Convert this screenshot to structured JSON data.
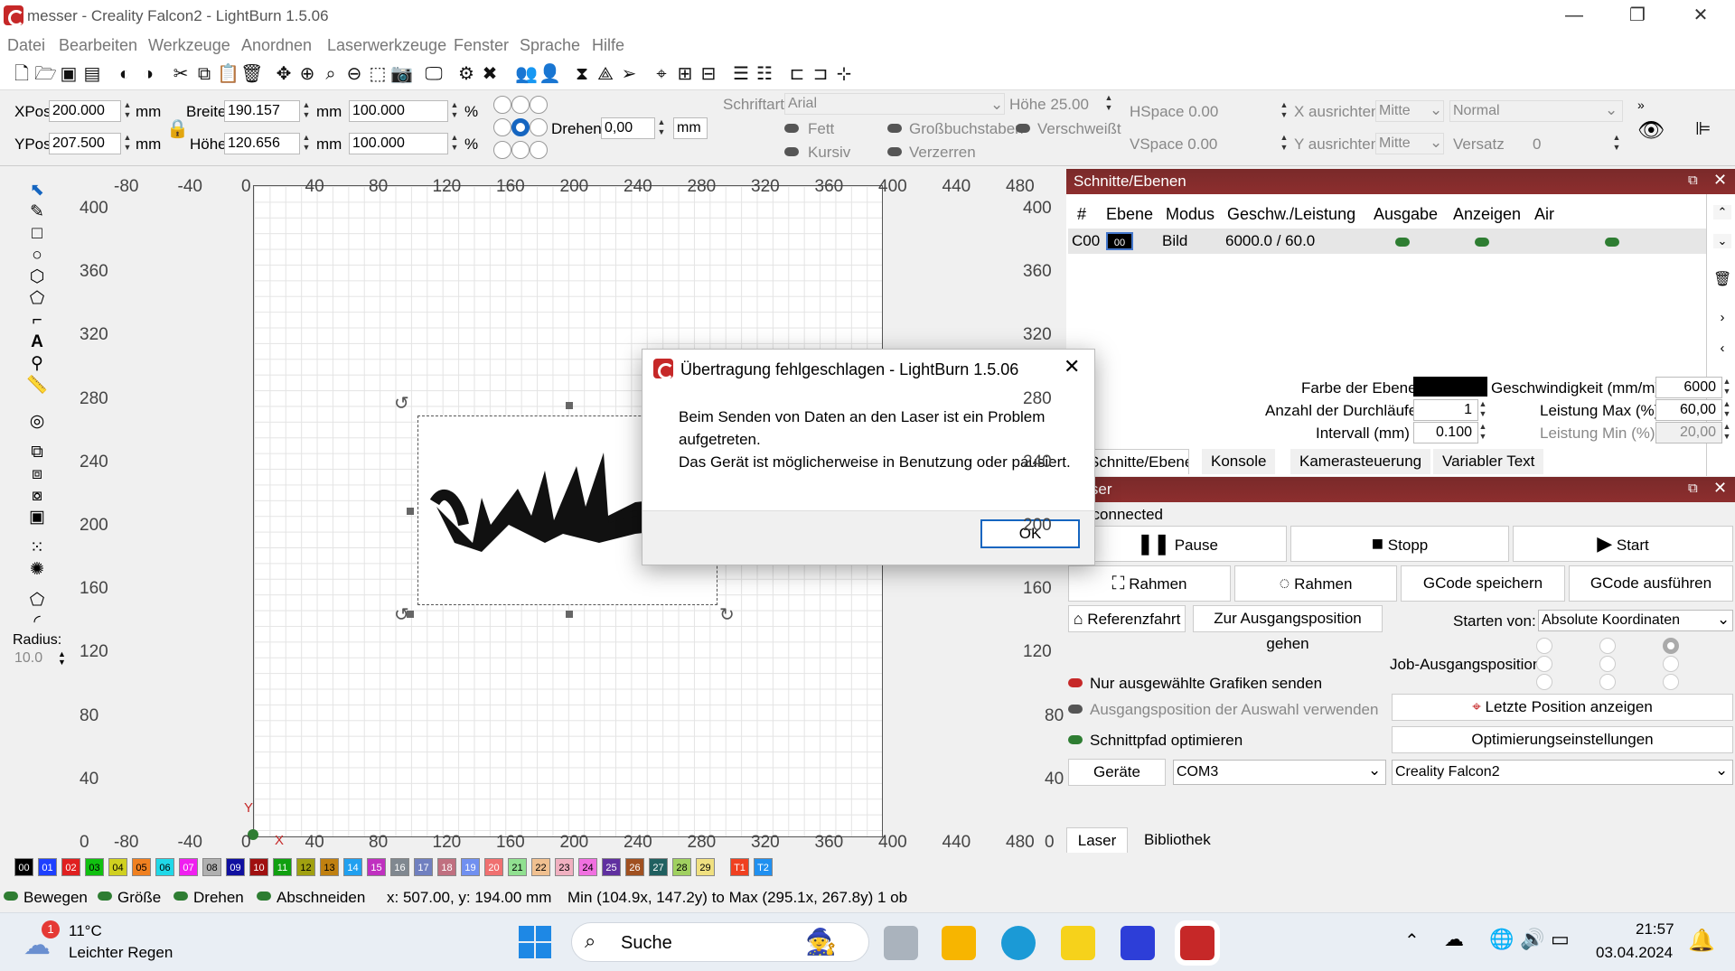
{
  "window": {
    "title": "messer - Creality Falcon2 - LightBurn 1.5.06"
  },
  "menu": [
    "Datei",
    "Bearbeiten",
    "Werkzeuge",
    "Anordnen",
    "Laserwerkzeuge",
    "Fenster",
    "Sprache",
    "Hilfe"
  ],
  "props": {
    "xpos_label": "XPos",
    "xpos": "200.000",
    "ypos_label": "YPos",
    "ypos": "207.500",
    "unit": "mm",
    "breite_label": "Breite",
    "breite": "190.157",
    "hoehe_label": "Höhe",
    "hoehe": "120.656",
    "scale_w": "100.000",
    "scale_h": "100.000",
    "percent": "%",
    "drehen_label": "Drehen",
    "drehen": "0,00",
    "drehen_unit": "mm",
    "schriftart_label": "Schriftart",
    "schriftart": "Arial",
    "hoehe_font": "Höhe 25.00",
    "hspace": "HSpace 0.00",
    "vspace": "VSpace 0.00",
    "x_ausrichten": "X ausrichten",
    "y_ausrichten": "Y ausrichten",
    "mitte": "Mitte",
    "normal": "Normal",
    "versatz": "Versatz",
    "versatz_val": "0",
    "fett": "Fett",
    "kursiv": "Kursiv",
    "gross": "Großbuchstaben",
    "verschweisst": "Verschweißt",
    "verzerren": "Verzerren"
  },
  "lefttools": {
    "radius_label": "Radius:",
    "radius": "10.0"
  },
  "ruler": {
    "top": [
      "-80",
      "-40",
      "0",
      "40",
      "80",
      "120",
      "160",
      "200",
      "240",
      "280",
      "320",
      "360",
      "400",
      "440",
      "480"
    ],
    "left": [
      "400",
      "360",
      "320",
      "280",
      "240",
      "200",
      "160",
      "120",
      "80",
      "40",
      "0"
    ],
    "right": [
      "400",
      "360",
      "320",
      "280",
      "240",
      "200",
      "160",
      "120",
      "80",
      "40",
      "0"
    ],
    "axis_x": "X",
    "axis_y": "Y"
  },
  "layers": {
    "title": "Schnitte/Ebenen",
    "headers": [
      "#",
      "Ebene",
      "Modus",
      "Geschw./Leistung",
      "Ausgabe",
      "Anzeigen",
      "Air"
    ],
    "row": {
      "id": "C00",
      "ebene": "00",
      "modus": "Bild",
      "speed": "6000.0 / 60.0"
    },
    "farbe_label": "Farbe der Ebene",
    "geschw_label": "Geschwindigkeit (mm/m)",
    "geschw": "6000",
    "durchlaeufe_label": "Anzahl der Durchläufe",
    "durchlaeufe": "1",
    "leistung_max_label": "Leistung Max (%)",
    "leistung_max": "60,00",
    "intervall_label": "Intervall (mm)",
    "intervall": "0.100",
    "leistung_min_label": "Leistung Min (%)",
    "leistung_min": "20,00",
    "tabs": [
      "Schnitte/Ebenen",
      "Konsole",
      "Kamerasteuerung",
      "Variabler Text"
    ]
  },
  "laser": {
    "title": "Laser",
    "status": "Disconnected",
    "pause": "Pause",
    "stopp": "Stopp",
    "start": "Start",
    "rahmen1": "Rahmen",
    "rahmen2": "Rahmen",
    "gcode_save": "GCode speichern",
    "gcode_run": "GCode ausführen",
    "referenz": "Referenzfahrt",
    "ausgang": "Zur Ausgangsposition gehen",
    "starten_label": "Starten von:",
    "starten": "Absolute Koordinaten",
    "job_label": "Job-Ausgangsposition",
    "nur_ausgewaehlt": "Nur ausgewählte Grafiken senden",
    "ausgang_auswahl": "Ausgangsposition der Auswahl verwenden",
    "letzte": "Letzte Position anzeigen",
    "optimieren": "Schnittpfad optimieren",
    "opt_settings": "Optimierungseinstellungen",
    "geraete": "Geräte",
    "port": "COM3",
    "device": "Creality Falcon2",
    "tabs": [
      "Laser",
      "Bibliothek"
    ]
  },
  "palette": [
    {
      "n": "00",
      "c": "#000000",
      "t": "#ffffff"
    },
    {
      "n": "01",
      "c": "#1e40ff",
      "t": "#ffffff"
    },
    {
      "n": "02",
      "c": "#e02020",
      "t": "#ffffff"
    },
    {
      "n": "03",
      "c": "#10c010",
      "t": "#000000"
    },
    {
      "n": "04",
      "c": "#d0d020",
      "t": "#000000"
    },
    {
      "n": "05",
      "c": "#f08020",
      "t": "#000000"
    },
    {
      "n": "06",
      "c": "#20d8e8",
      "t": "#000000"
    },
    {
      "n": "07",
      "c": "#f020f0",
      "t": "#ffffff"
    },
    {
      "n": "08",
      "c": "#b0b0b0",
      "t": "#000000"
    },
    {
      "n": "09",
      "c": "#1010a0",
      "t": "#ffffff"
    },
    {
      "n": "10",
      "c": "#a01010",
      "t": "#ffffff"
    },
    {
      "n": "11",
      "c": "#10a010",
      "t": "#ffffff"
    },
    {
      "n": "12",
      "c": "#a0a010",
      "t": "#000000"
    },
    {
      "n": "13",
      "c": "#c08010",
      "t": "#000000"
    },
    {
      "n": "14",
      "c": "#20a0f0",
      "t": "#ffffff"
    },
    {
      "n": "15",
      "c": "#c030c0",
      "t": "#ffffff"
    },
    {
      "n": "16",
      "c": "#808890",
      "t": "#ffffff"
    },
    {
      "n": "17",
      "c": "#7080c0",
      "t": "#ffffff"
    },
    {
      "n": "18",
      "c": "#c07080",
      "t": "#ffffff"
    },
    {
      "n": "19",
      "c": "#7090f0",
      "t": "#ffffff"
    },
    {
      "n": "20",
      "c": "#f07070",
      "t": "#ffffff"
    },
    {
      "n": "21",
      "c": "#90e090",
      "t": "#000000"
    },
    {
      "n": "22",
      "c": "#f0c090",
      "t": "#000000"
    },
    {
      "n": "23",
      "c": "#f0b0c0",
      "t": "#000000"
    },
    {
      "n": "24",
      "c": "#f070e0",
      "t": "#000000"
    },
    {
      "n": "25",
      "c": "#6030a0",
      "t": "#ffffff"
    },
    {
      "n": "26",
      "c": "#a05020",
      "t": "#ffffff"
    },
    {
      "n": "27",
      "c": "#206060",
      "t": "#ffffff"
    },
    {
      "n": "28",
      "c": "#a0d060",
      "t": "#000000"
    },
    {
      "n": "29",
      "c": "#f0e080",
      "t": "#000000"
    },
    {
      "n": "T1",
      "c": "#f04020",
      "t": "#ffffff"
    },
    {
      "n": "T2",
      "c": "#2090f0",
      "t": "#ffffff"
    }
  ],
  "status": {
    "bewegen": "Bewegen",
    "groesse": "Größe",
    "drehen": "Drehen",
    "abschneiden": "Abschneiden",
    "coords": "x: 507.00, y: 194.00 mm",
    "minmax": "Min (104.9x, 147.2y) to Max (295.1x, 267.8y)  1 ob"
  },
  "dialog": {
    "title": "Übertragung fehlgeschlagen - LightBurn 1.5.06",
    "line1": "Beim Senden von Daten an den Laser ist ein Problem aufgetreten.",
    "line2": "Das Gerät ist möglicherweise in Benutzung oder pausiert.",
    "ok": "OK"
  },
  "taskbar": {
    "temp": "11°C",
    "weather": "Leichter Regen",
    "search": "Suche",
    "time": "21:57",
    "date": "03.04.2024",
    "badge": "1"
  }
}
